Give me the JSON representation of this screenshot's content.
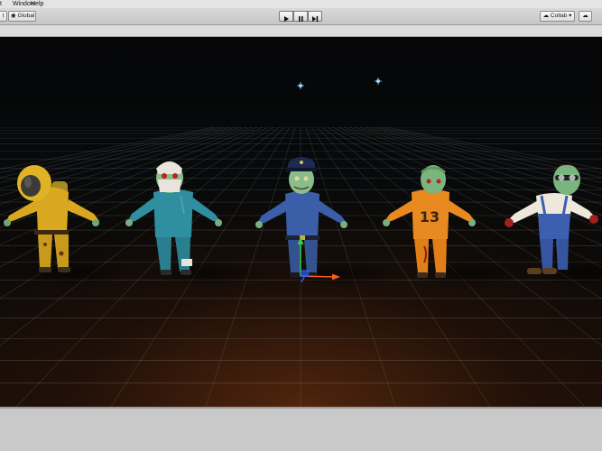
{
  "menu": {
    "partial_left": "t",
    "items": [
      "Window",
      "Help"
    ]
  },
  "toolbar": {
    "left_partial": "t",
    "global_label": "Global",
    "collab_label": "Collab",
    "play_controls": [
      "play-icon",
      "pause-icon",
      "step-icon"
    ]
  },
  "scene": {
    "characters": [
      {
        "name": "hazmat-zombie",
        "suit_color": "#d9a820"
      },
      {
        "name": "doctor-zombie",
        "suit_color": "#2f8fa0"
      },
      {
        "name": "police-zombie",
        "suit_color": "#3a5ea8"
      },
      {
        "name": "prisoner-zombie",
        "suit_color": "#e88a20",
        "chest_number": "13"
      },
      {
        "name": "farmer-zombie",
        "suit_color": "#3d5fb0"
      }
    ],
    "gizmo_colors": {
      "x_axis": "#ff5a1e",
      "y_axis": "#38d040",
      "z_axis": "#2a60ff"
    }
  }
}
